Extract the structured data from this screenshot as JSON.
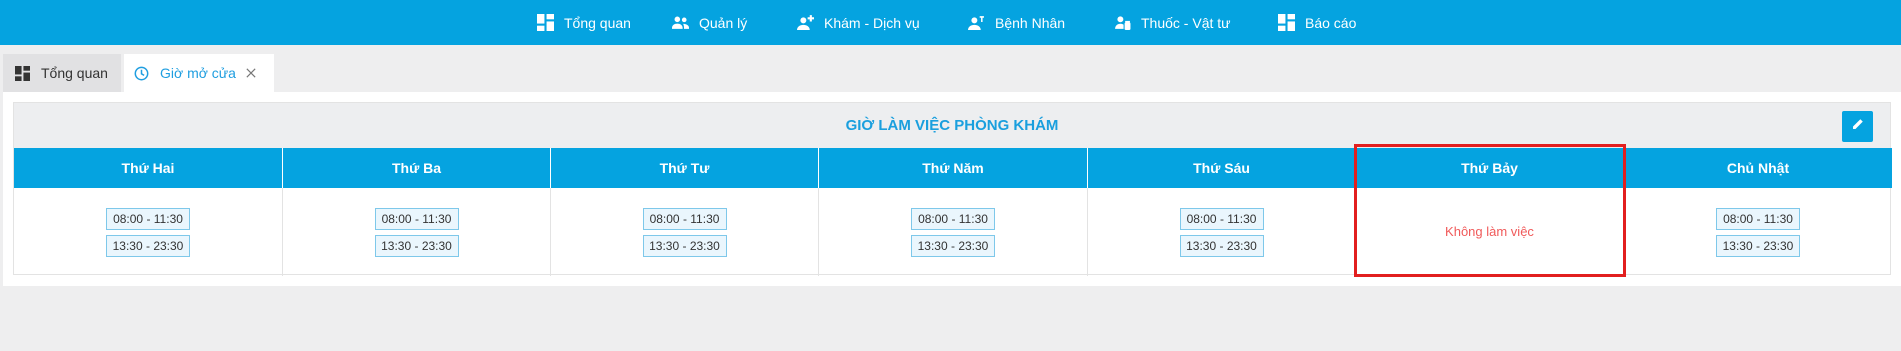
{
  "nav": {
    "items": [
      {
        "label": "Tổng quan",
        "icon": "dashboard-icon"
      },
      {
        "label": "Quản lý",
        "icon": "people-icon"
      },
      {
        "label": "Khám - Dịch vụ",
        "icon": "doctor-icon"
      },
      {
        "label": "Bệnh Nhân",
        "icon": "patient-icon"
      },
      {
        "label": "Thuốc - Vật tư",
        "icon": "medicine-icon"
      },
      {
        "label": "Báo cáo",
        "icon": "report-icon"
      }
    ]
  },
  "tabs": [
    {
      "label": "Tổng quan",
      "icon": "dashboard-icon",
      "active": false
    },
    {
      "label": "Giờ mở cửa",
      "icon": "clock-icon",
      "active": true,
      "closable": true
    }
  ],
  "schedule": {
    "title": "GIỜ LÀM VIỆC PHÒNG KHÁM",
    "edit_icon": "pencil-icon",
    "off_label": "Không làm việc",
    "days": [
      {
        "name": "Thứ Hai",
        "slots": [
          "08:00 - 11:30",
          "13:30 - 23:30"
        ]
      },
      {
        "name": "Thứ Ba",
        "slots": [
          "08:00 - 11:30",
          "13:30 - 23:30"
        ]
      },
      {
        "name": "Thứ Tư",
        "slots": [
          "08:00 - 11:30",
          "13:30 - 23:30"
        ]
      },
      {
        "name": "Thứ Năm",
        "slots": [
          "08:00 - 11:30",
          "13:30 - 23:30"
        ]
      },
      {
        "name": "Thứ Sáu",
        "slots": [
          "08:00 - 11:30",
          "13:30 - 23:30"
        ]
      },
      {
        "name": "Thứ Bảy",
        "slots": []
      },
      {
        "name": "Chủ Nhật",
        "slots": [
          "08:00 - 11:30",
          "13:30 - 23:30"
        ]
      }
    ]
  },
  "colors": {
    "primary": "#05a3e0",
    "title": "#1a9fde",
    "off_text": "#f05a5a",
    "highlight": "#e21f1f"
  }
}
